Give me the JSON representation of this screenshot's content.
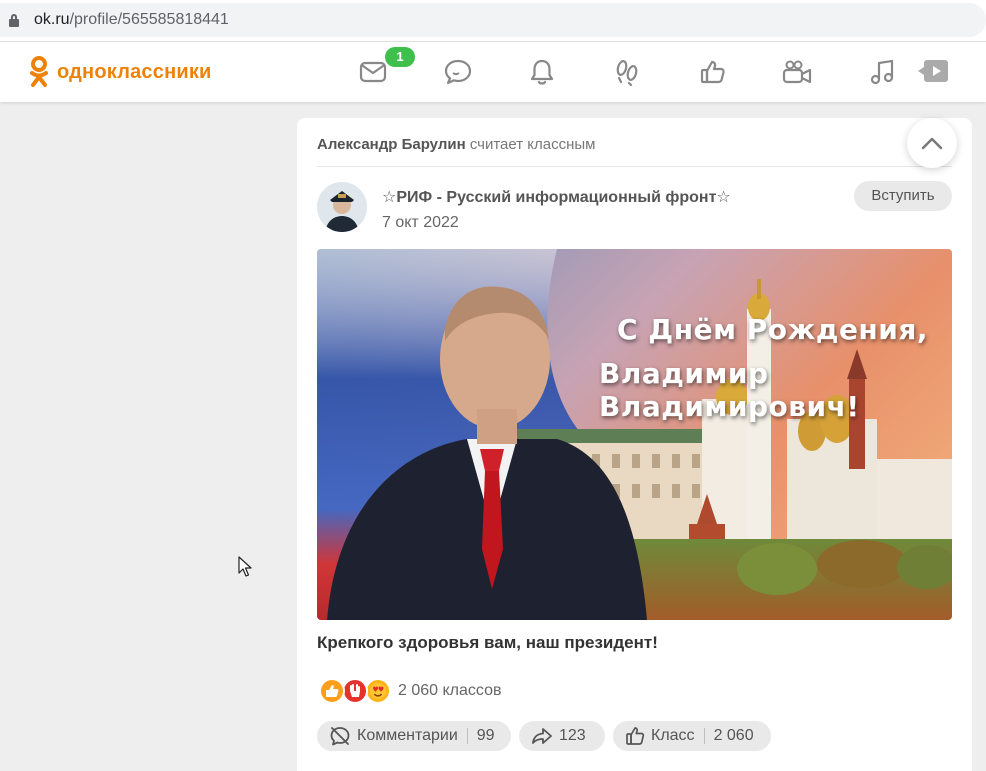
{
  "browser": {
    "url_domain": "ok.ru",
    "url_path": "/profile/565585818441"
  },
  "header": {
    "logo_text": "одноклассники",
    "brand_color": "#ee8208",
    "badge_color": "#3fc04c",
    "nav": [
      {
        "icon": "messages-icon",
        "badge": "1"
      },
      {
        "icon": "discussions-icon"
      },
      {
        "icon": "notifications-icon"
      },
      {
        "icon": "guests-icon"
      },
      {
        "icon": "marks-icon"
      },
      {
        "icon": "video-icon"
      },
      {
        "icon": "music-icon"
      },
      {
        "icon": "video-play-icon"
      }
    ]
  },
  "post": {
    "activity_actor": "Александр Барулин",
    "activity_verb": "считает классным",
    "group_name": "☆РИФ - Русский информационный фронт☆",
    "date": "7 окт 2022",
    "join_label": "Вступить",
    "image_text_line1": "С Днём Рождения,",
    "image_text_line2": "Владимир Владимирович!",
    "caption": "Крепкого здоровья вам, наш президент!",
    "reactions_count": "2 060 классов",
    "actions": {
      "comments_label": "Комментарии",
      "comments_count": "99",
      "shares_count": "123",
      "likes_label": "Класс",
      "likes_count": "2 060"
    }
  }
}
